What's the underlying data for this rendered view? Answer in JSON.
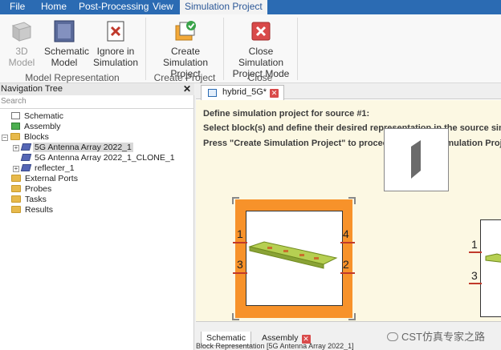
{
  "menubar": {
    "items": [
      "File",
      "Home",
      "Post-Processing",
      "View",
      "Simulation Project"
    ],
    "active": "Simulation Project"
  },
  "ribbon": {
    "buttons": {
      "model_3d": "3D Model",
      "schematic_model_1": "Schematic",
      "schematic_model_2": "Model",
      "ignore_1": "Ignore in",
      "ignore_2": "Simulation",
      "create_1": "Create Simulation",
      "create_2": "Project",
      "close_1": "Close Simulation",
      "close_2": "Project Mode"
    },
    "groups": {
      "model_representation": "Model Representation",
      "create_project": "Create Project",
      "close": "Close"
    }
  },
  "navigation": {
    "title": "Navigation Tree",
    "close_glyph": "✕",
    "search_placeholder": "Search",
    "items": [
      "Schematic",
      "Assembly",
      "Blocks",
      "5G Antenna Array 2022_1",
      "5G Antenna Array 2022_1_CLONE_1",
      "reflecter_1",
      "External Ports",
      "Probes",
      "Tasks",
      "Results"
    ]
  },
  "document": {
    "tab_title": "hybrid_5G*",
    "instructions": [
      "Define simulation project for source #1:",
      "Select block(s) and define their desired representation in the source simul",
      "Press \"Create Simulation Project\" to proceed or \"Close Simulation Project"
    ],
    "ports_left": [
      "1",
      "3"
    ],
    "ports_right": [
      "4",
      "2"
    ],
    "ports_far": [
      "1",
      "3"
    ]
  },
  "bottom_tabs": [
    "Schematic",
    "Assembly"
  ],
  "status": "Block Representation [5G Antenna Array 2022_1]",
  "watermark": "CST仿真专家之路",
  "colors": {
    "menubar": "#2b6bb3",
    "selected_block": "#f7922a",
    "canvas": "#fcf8e3"
  }
}
